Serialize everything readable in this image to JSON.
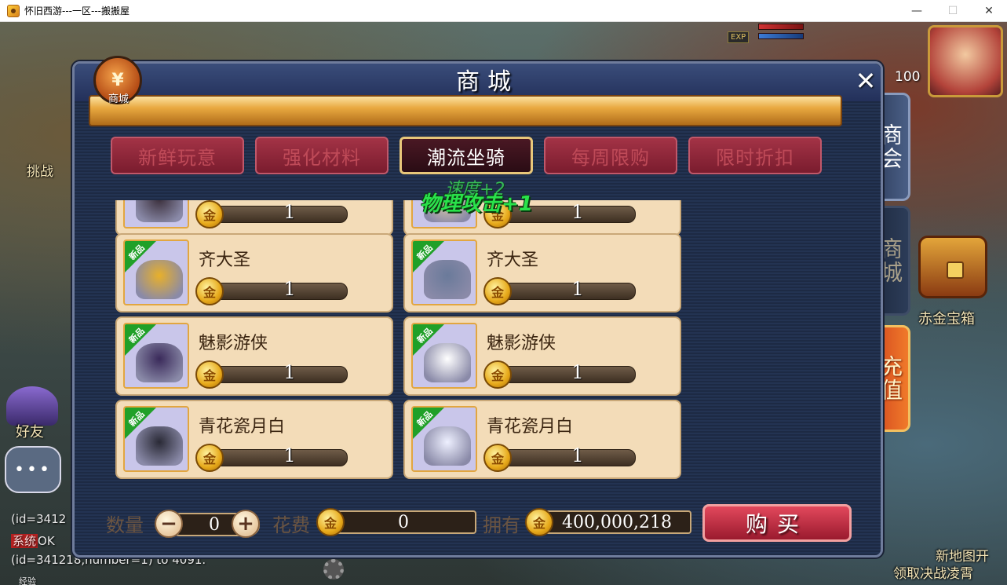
{
  "window": {
    "title": "怀旧西游---一区---搬搬屋",
    "minimize": "—",
    "maximize": "☐",
    "close": "✕"
  },
  "hud": {
    "challenge_label": "挑战",
    "friend_label": "好友",
    "treasure_label": "赤金宝箱",
    "new_map_line1": "新地图开",
    "new_map_line2": "领取决战凌霄",
    "avatar_level": "100",
    "exp_badge": "EXP",
    "chat_dots": "•••",
    "chat": [
      {
        "tag": "",
        "text": "(id=3412"
      },
      {
        "tag": "系统",
        "text": "OK"
      },
      {
        "tag": "",
        "text": "(id=341218,number=1) to 4091."
      }
    ],
    "exp_label": "经验"
  },
  "side_tabs": {
    "shanghui": "商会",
    "shangcheng": "商城",
    "chongzhi": "充值"
  },
  "shop": {
    "title": "商城",
    "badge_icon": "¥",
    "badge_label": "商城",
    "close": "✕",
    "categories": [
      {
        "label": "新鲜玩意",
        "active": false
      },
      {
        "label": "强化材料",
        "active": false
      },
      {
        "label": "潮流坐骑",
        "active": true
      },
      {
        "label": "每周限购",
        "active": false
      },
      {
        "label": "限时折扣",
        "active": false
      }
    ],
    "float_text": "物理攻击+1",
    "float_text_faded": "速度+2",
    "new_tag": "新品",
    "coin_icon": "金",
    "items": [
      {
        "name": "",
        "price": "1",
        "color": "#3a2e3a"
      },
      {
        "name": "",
        "price": "1",
        "color": "#e8d2a8"
      },
      {
        "name": "齐大圣",
        "price": "1",
        "color": "#e8b02a"
      },
      {
        "name": "齐大圣",
        "price": "1",
        "color": "#6a7a9a"
      },
      {
        "name": "魅影游侠",
        "price": "1",
        "color": "#3a2a5a"
      },
      {
        "name": "魅影游侠",
        "price": "1",
        "color": "#ffffff"
      },
      {
        "name": "青花瓷月白",
        "price": "1",
        "color": "#2a2a36"
      },
      {
        "name": "青花瓷月白",
        "price": "1",
        "color": "#eef0ff"
      }
    ],
    "bottom": {
      "qty_label": "数量",
      "qty_value": "0",
      "minus": "−",
      "plus": "+",
      "cost_label": "花费",
      "cost_value": "0",
      "own_label": "拥有",
      "own_value": "400,000,218",
      "buy_label": "购买"
    }
  }
}
